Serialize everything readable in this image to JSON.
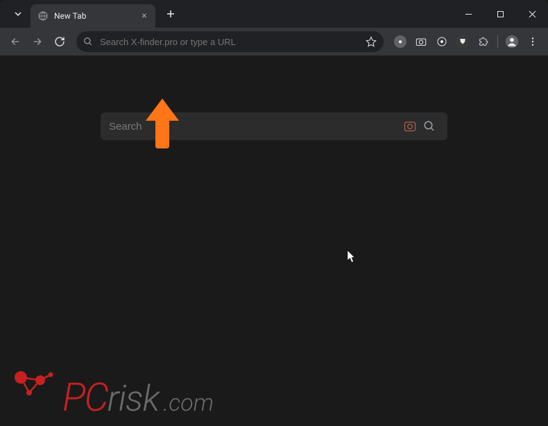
{
  "window": {
    "tab_title": "New Tab"
  },
  "toolbar": {
    "omnibox_placeholder": "Search X-finder.pro or type a URL"
  },
  "page": {
    "search_placeholder": "Search"
  },
  "watermark": {
    "pc": "PC",
    "risk": "risk",
    "com": ".com"
  }
}
